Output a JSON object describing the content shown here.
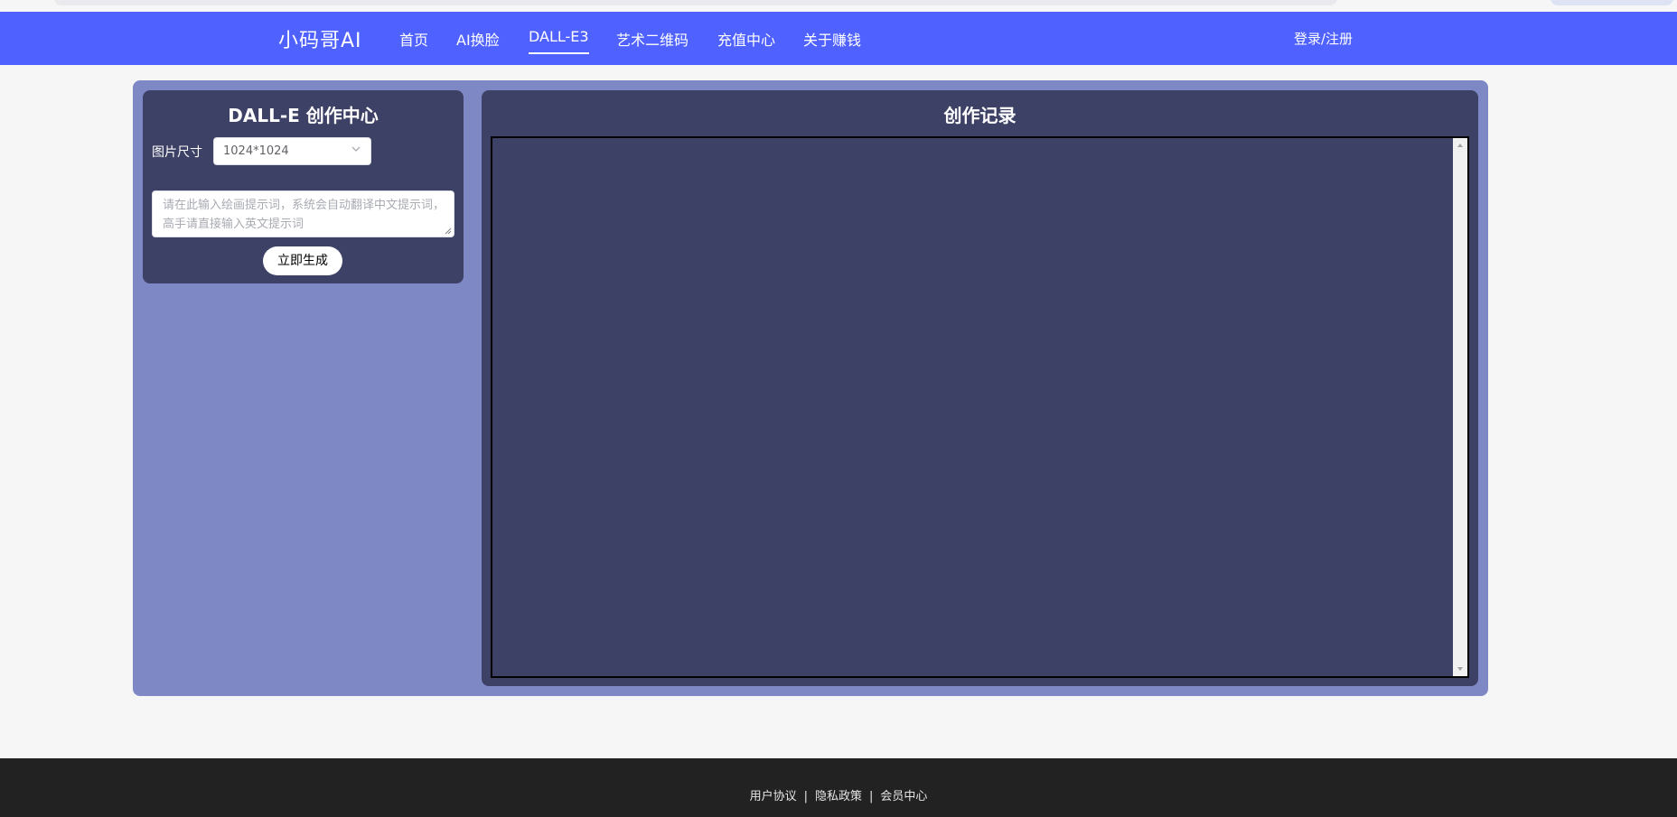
{
  "brand": "小码哥AI",
  "nav": {
    "items": [
      {
        "label": "首页",
        "active": false
      },
      {
        "label": "AI换脸",
        "active": false
      },
      {
        "label": "DALL-E3",
        "active": true
      },
      {
        "label": "艺术二维码",
        "active": false
      },
      {
        "label": "充值中心",
        "active": false
      },
      {
        "label": "关于赚钱",
        "active": false
      }
    ],
    "login_label": "登录/注册",
    "accent_color": "#4f61fe"
  },
  "creator": {
    "title": "DALL-E 创作中心",
    "size_label": "图片尺寸",
    "size_value": "1024*1024",
    "prompt_placeholder": "请在此输入绘画提示词，系统会自动翻译中文提示词，高手请直接输入英文提示词",
    "generate_label": "立即生成"
  },
  "records": {
    "title": "创作记录"
  },
  "footer": {
    "links": [
      "用户协议",
      "隐私政策",
      "会员中心"
    ],
    "separator": "|"
  },
  "icons": {
    "select_chevron": "chevron-down-icon",
    "scroll_up": "scroll-up-arrow-icon",
    "scroll_down": "scroll-down-arrow-icon",
    "resize": "resize-grip-icon"
  }
}
